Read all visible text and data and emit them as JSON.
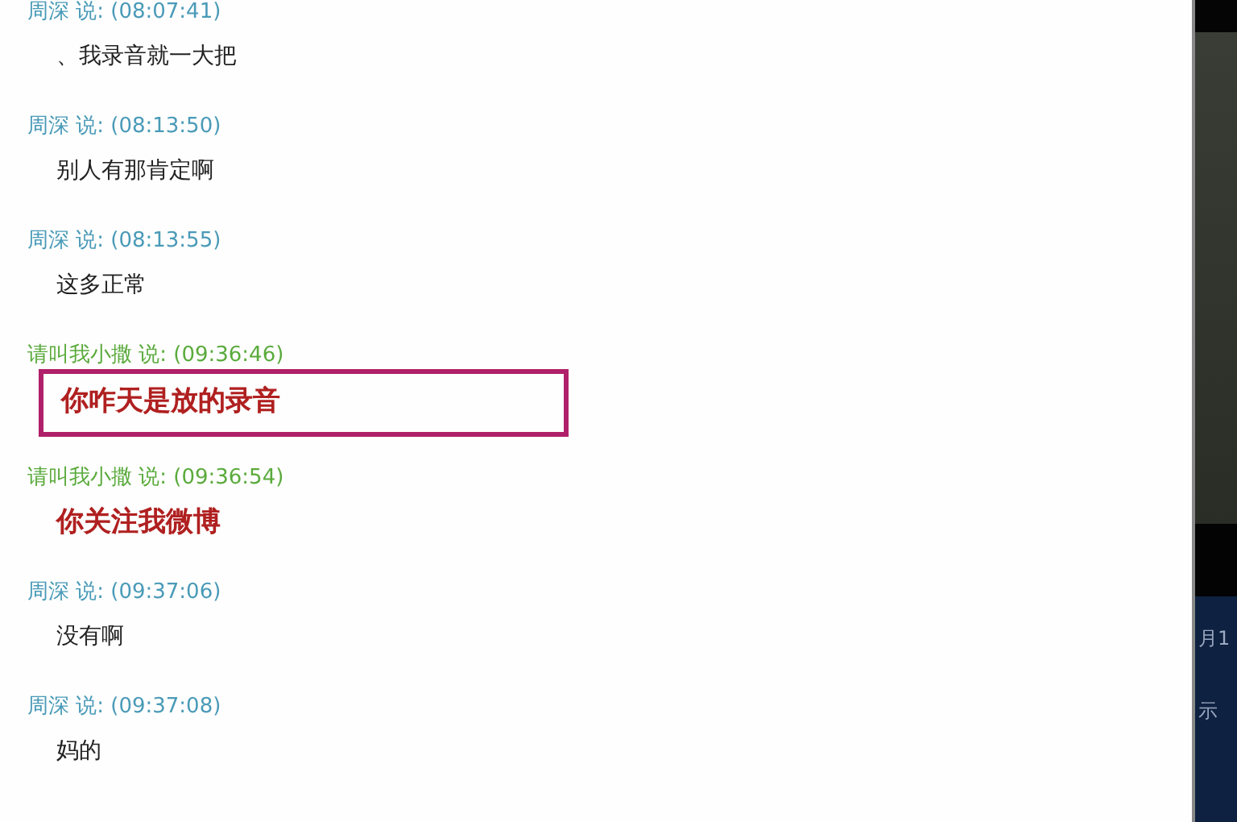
{
  "messages": [
    {
      "header": "周深 说: (08:07:41)",
      "color": "#4a9ab8",
      "text": "、我录音就一大把",
      "kind": "plain",
      "highlighted": false
    },
    {
      "header": "周深 说: (08:13:50)",
      "color": "#4a9ab8",
      "text": "别人有那肯定啊",
      "kind": "plain",
      "highlighted": false
    },
    {
      "header": "周深 说: (08:13:55)",
      "color": "#4a9ab8",
      "text": "这多正常",
      "kind": "plain",
      "highlighted": false
    },
    {
      "header": "请叫我小撒 说: (09:36:46)",
      "color": "#5aaa3c",
      "text": "你咋天是放的录音",
      "kind": "emphasis",
      "highlighted": true
    },
    {
      "header": "请叫我小撒 说: (09:36:54)",
      "color": "#5aaa3c",
      "text": "你关注我微博",
      "kind": "emphasis",
      "highlighted": false
    },
    {
      "header": "周深 说: (09:37:06)",
      "color": "#4a9ab8",
      "text": "没有啊",
      "kind": "plain",
      "highlighted": false
    },
    {
      "header": "周深 说: (09:37:08)",
      "color": "#4a9ab8",
      "text": "妈的",
      "kind": "plain",
      "highlighted": false
    }
  ],
  "side_panel": {
    "texts": [
      "月1",
      "示"
    ]
  }
}
